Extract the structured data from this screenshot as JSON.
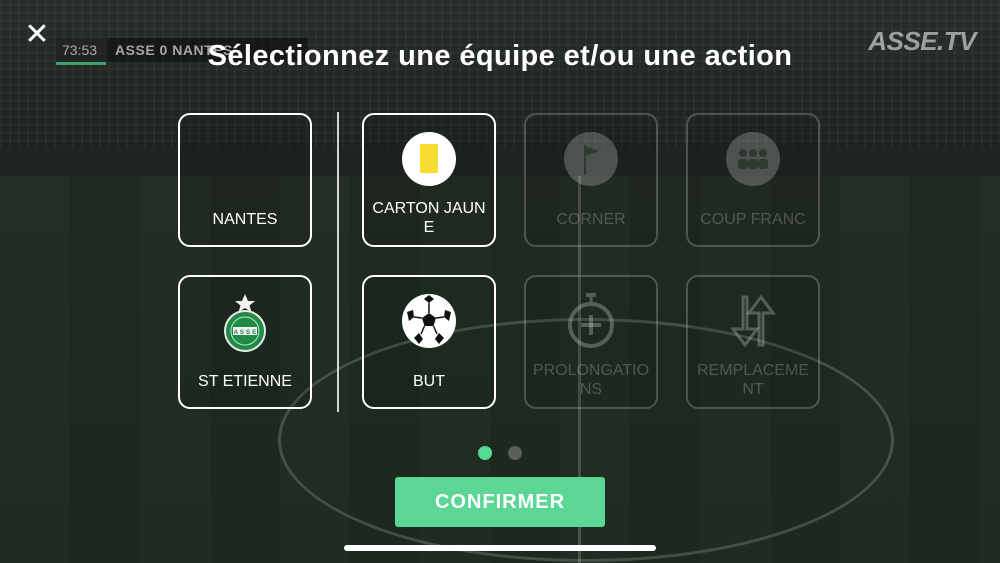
{
  "overlay": {
    "title": "Sélectionnez une équipe et/ou une action",
    "close_symbol": "✕",
    "brand": "ASSE.TV"
  },
  "scorebar": {
    "time": "73:53",
    "teams": "ASSE  0  NANTES"
  },
  "teams": [
    {
      "label": "NANTES"
    },
    {
      "label": "ST ETIENNE",
      "icon": "asse-crest-icon"
    }
  ],
  "actions": [
    {
      "label": "CARTON JAUNE",
      "icon": "yellow-card-icon",
      "enabled": true
    },
    {
      "label": "CORNER",
      "icon": "corner-flag-icon",
      "enabled": false
    },
    {
      "label": "COUP FRANC",
      "icon": "wall-players-icon",
      "enabled": false
    },
    {
      "label": "BUT",
      "icon": "soccer-ball-icon",
      "enabled": true
    },
    {
      "label": "PROLONGATIONS",
      "icon": "stopwatch-plus-icon",
      "enabled": false
    },
    {
      "label": "REMPLACEMENT",
      "icon": "substitution-arrows-icon",
      "enabled": false
    }
  ],
  "pager": {
    "current_page": 1,
    "total_pages": 2
  },
  "confirm_label": "CONFIRMER",
  "colors": {
    "accent": "#5bd694",
    "card_yellow": "#f6dd2f",
    "asse_green": "#1f8b45"
  }
}
